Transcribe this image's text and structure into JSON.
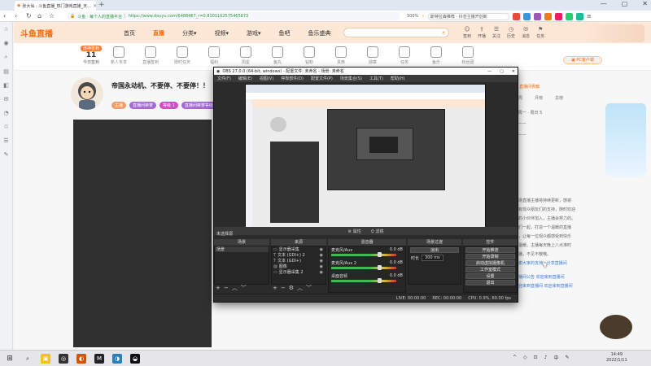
{
  "browser": {
    "tab_title": "张大仙 · 斗鱼直播_热门游戏直播_天…",
    "new_tab": "+",
    "window_controls": [
      "—",
      "▢",
      "✕"
    ],
    "address_site": "斗鱼 · 每个人的直播平台",
    "url": "https://www.douyu.com/6488467_r=0.8101162575465873",
    "zoom": "100%",
    "search_text": "斯特拉森推荐 · 抖音主播开创新",
    "nav_icons": [
      "‹",
      "›",
      "↻",
      "⌂",
      "☆"
    ]
  },
  "sidebar": {
    "icons": [
      "☆",
      "◉",
      "⌕",
      "▤",
      "◧",
      "✉",
      "◔",
      "♲",
      "☰",
      "✎"
    ]
  },
  "douyu": {
    "logo": "斗鱼直播",
    "nav": [
      "首页",
      "直播",
      "分类▾",
      "视频▾",
      "游戏▾",
      "鱼吧",
      "鱼乐盛典"
    ],
    "search_icon": "⌕",
    "header_icons": [
      {
        "glyph": "☺",
        "label": "签到"
      },
      {
        "glyph": "⇪",
        "label": "开播"
      },
      {
        "glyph": "☰",
        "label": "关注"
      },
      {
        "glyph": "◷",
        "label": "历史"
      },
      {
        "glyph": "✉",
        "label": "消息"
      },
      {
        "glyph": "⚑",
        "label": "任务"
      }
    ],
    "strip": {
      "day_badge": "连续签到",
      "day_number": "11",
      "day_label": "今日签到",
      "items": [
        "新人专享",
        "直播签到",
        "限时任务",
        "福利",
        "周星",
        "鱼丸",
        "钻粉",
        "贵族",
        "勋章",
        "任务",
        "鱼乐",
        "粉丝团"
      ]
    },
    "pc_button": "▣ PC客户端",
    "stream": {
      "title": "帝国永动机、不要停、不要停！！",
      "tags": [
        {
          "text": "主播",
          "color": "#f39c6b"
        },
        {
          "text": "直播间荣誉",
          "color": "#a46ad6"
        },
        {
          "text": "等级 1",
          "color": "#d54bc1"
        },
        {
          "text": "直播间荣誉等级",
          "color": "#a46ad6"
        }
      ]
    },
    "right": {
      "top_label": "♦ 直播间贡献",
      "tabs": [
        "本周",
        "月榜",
        "总榜"
      ],
      "lines": [
        "1 周一 · 周日 5",
        "2 ——",
        "3 ——",
        "本场直播主播将持续更新，感谢",
        "所有观众朋友们的支持，随时欢迎",
        "新的小伙伴加入，主播会努力的。",
        "我们一起，打造一个温暖的直播",
        "间，让每一位观众都感受到快乐",
        "和温暖。主播每天晚上八点准时",
        "开播，不见不散哦。",
        "感谢大家的支持 · 分享直播间",
        "直播间公告 欢迎来到直播间",
        "欢迎来到直播间 欢迎来到直播间"
      ]
    }
  },
  "obs": {
    "title": "OBS 27.0.0 (64-bit, windows) - 配置文件: 未命名 - 场景: 未命名",
    "window_controls": [
      "—",
      "▢",
      "✕"
    ],
    "menu": [
      "文件(F)",
      "编辑(E)",
      "视图(V)",
      "停靠部件(D)",
      "配置文件(P)",
      "场景集合(S)",
      "工具(T)",
      "帮助(H)"
    ],
    "preview_bar": [
      "⚙ 属性",
      "⛭ 滤镜"
    ],
    "no_source": "未选择源",
    "panels": {
      "scenes": {
        "title": "场景",
        "items": [
          "场景"
        ]
      },
      "sources": {
        "title": "来源",
        "items": [
          "显示器采集",
          "文本 (GDI+) 2",
          "文本 (GDI+)",
          "图像",
          "显示器采集 2"
        ]
      },
      "mixer": {
        "title": "混音器",
        "channels": [
          {
            "name": "麦克风/Aux",
            "db": "0.0 dB"
          },
          {
            "name": "麦克风/Aux 2",
            "db": "0.0 dB"
          },
          {
            "name": "桌面音频",
            "db": "0.0 dB"
          }
        ]
      },
      "transitions": {
        "title": "场景过渡",
        "type_label": "淡出",
        "duration_label": "时长",
        "duration": "300 ms"
      },
      "controls": {
        "title": "控件",
        "buttons": [
          "开始推流",
          "开始录制",
          "启动虚拟摄像机",
          "工作室模式",
          "设置",
          "退出"
        ]
      }
    },
    "status": [
      "LIVE: 00:00:00",
      "REC: 00:00:00",
      "CPU: 0.9%, 60.00 fps"
    ]
  },
  "taskbar": {
    "apps": [
      "⊞",
      "⌕",
      "▣",
      "◎",
      "◐",
      "M",
      "◑",
      "◒"
    ],
    "tray": [
      "^",
      "◇",
      "⊡",
      "♪",
      "中",
      "✎"
    ],
    "time": "14:49",
    "date": "2022/1/11"
  }
}
